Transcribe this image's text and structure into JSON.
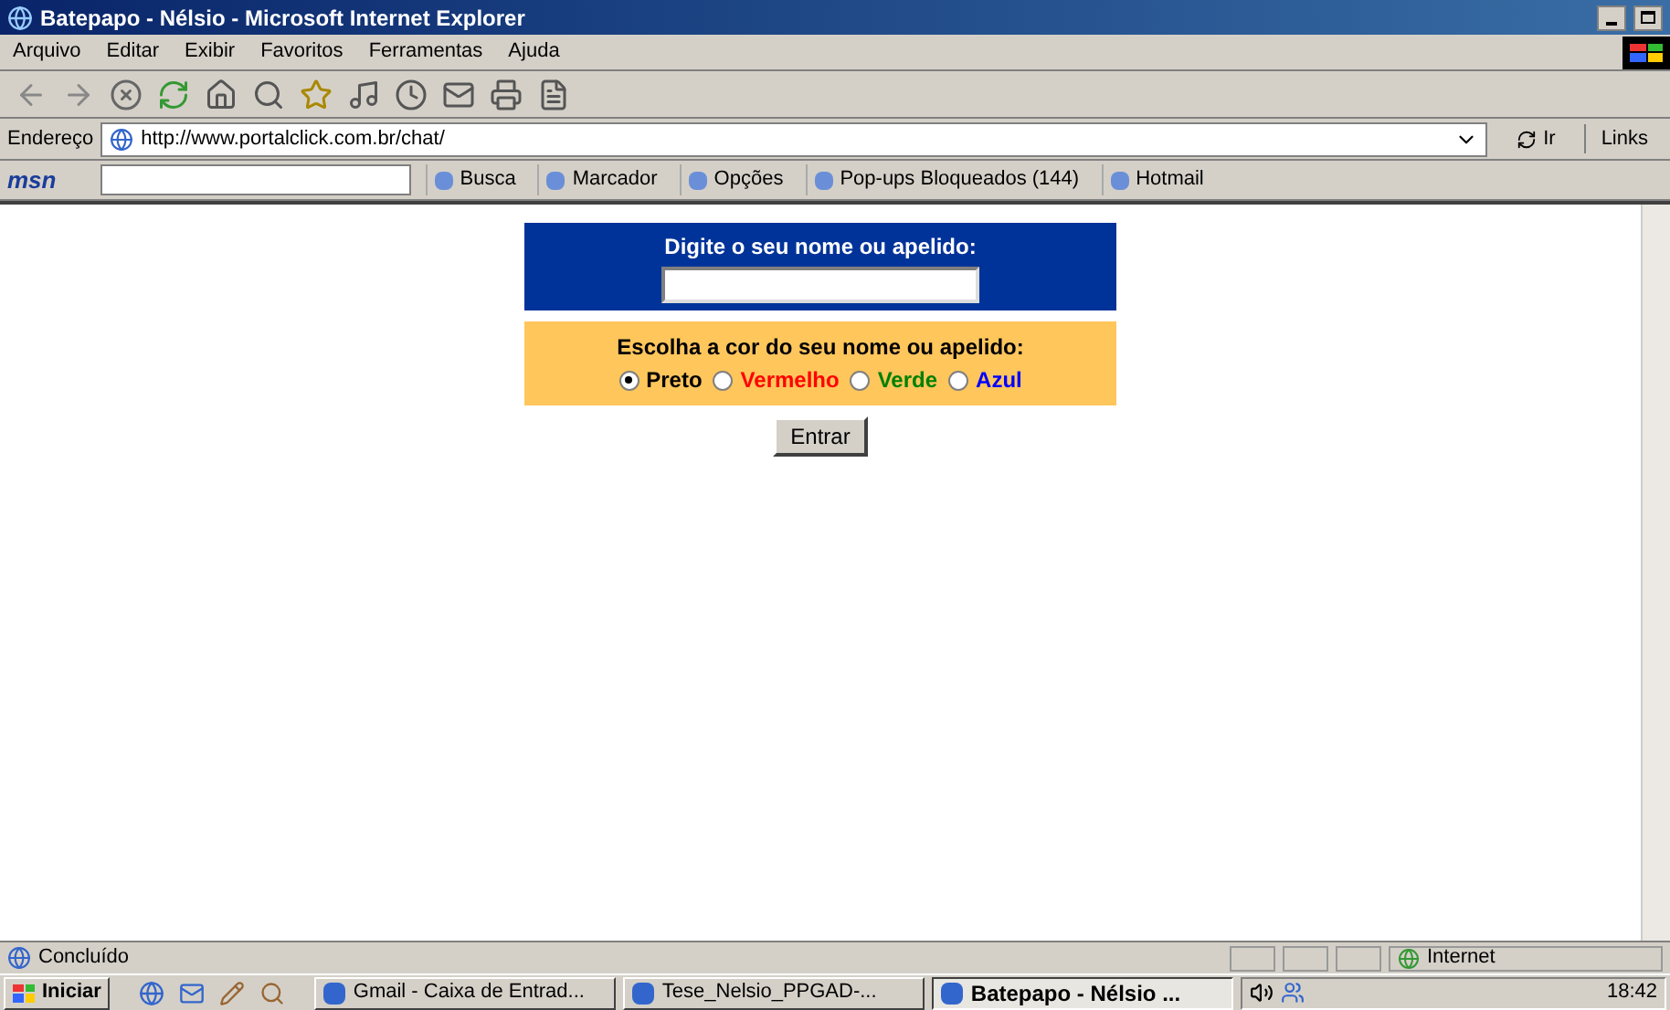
{
  "window": {
    "title": "Batepapo - Nélsio - Microsoft Internet Explorer"
  },
  "menu": [
    "Arquivo",
    "Editar",
    "Exibir",
    "Favoritos",
    "Ferramentas",
    "Ajuda"
  ],
  "address_bar": {
    "label": "Endereço",
    "url": "http://www.portalclick.com.br/chat/",
    "go": "Ir",
    "links": "Links"
  },
  "msn_bar": {
    "logo": "msn",
    "items": [
      {
        "label": "Busca"
      },
      {
        "label": "Marcador"
      },
      {
        "label": "Opções"
      },
      {
        "label": "Pop-ups Bloqueados (144)"
      },
      {
        "label": "Hotmail"
      }
    ]
  },
  "form": {
    "name_prompt": "Digite o seu nome ou apelido:",
    "color_prompt": "Escolha a cor do seu nome ou apelido:",
    "colors": [
      {
        "label": "Preto",
        "color": "#000000",
        "selected": true
      },
      {
        "label": "Vermelho",
        "color": "#ff0000",
        "selected": false
      },
      {
        "label": "Verde",
        "color": "#008000",
        "selected": false
      },
      {
        "label": "Azul",
        "color": "#0000ff",
        "selected": false
      }
    ],
    "button": "Entrar"
  },
  "status_bar": {
    "text": "Concluído",
    "zone": "Internet"
  },
  "taskbar": {
    "start": "Iniciar",
    "tasks": [
      {
        "label": "Gmail - Caixa de Entrad...",
        "selected": false
      },
      {
        "label": "Tese_Nelsio_PPGAD-...",
        "selected": false
      },
      {
        "label": "Batepapo - Nélsio ...",
        "selected": true
      }
    ],
    "clock": "18:42"
  }
}
